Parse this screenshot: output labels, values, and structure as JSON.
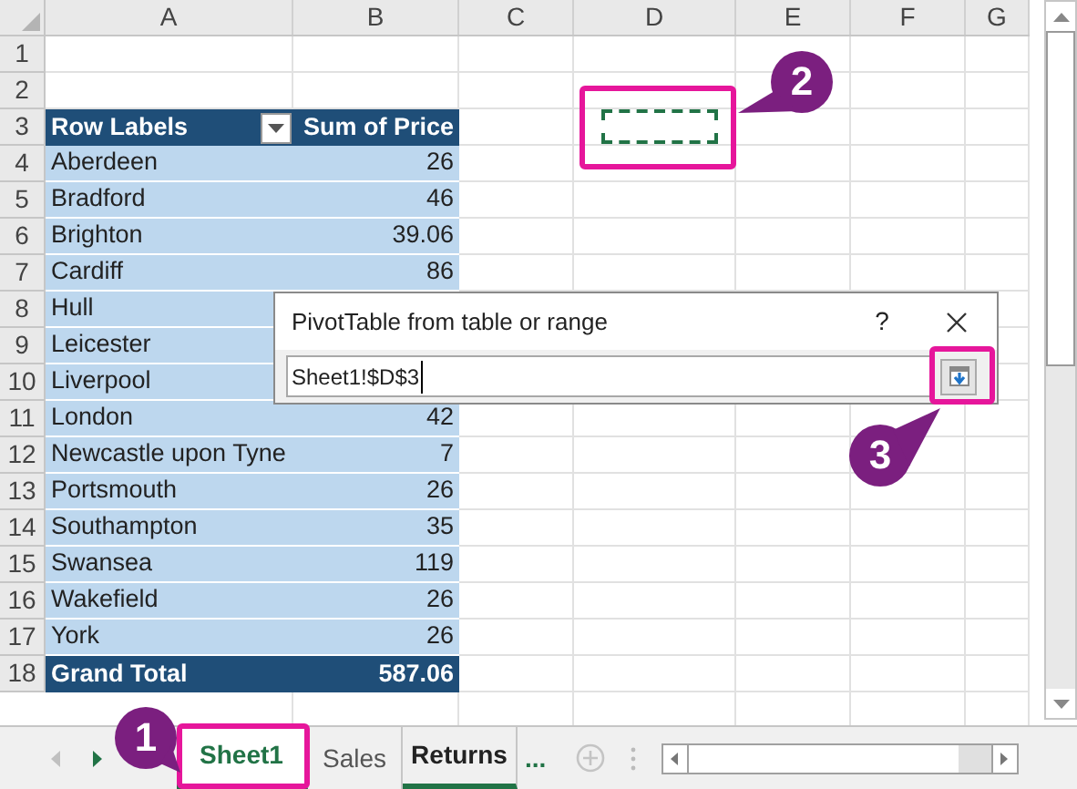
{
  "columns": [
    "A",
    "B",
    "C",
    "D",
    "E",
    "F",
    "G"
  ],
  "row_numbers": [
    "1",
    "2",
    "3",
    "4",
    "5",
    "6",
    "7",
    "8",
    "9",
    "10",
    "11",
    "12",
    "13",
    "14",
    "15",
    "16",
    "17",
    "18"
  ],
  "pivot_table": {
    "row_labels": "Row Labels",
    "value_header": "Sum of Price",
    "rows": [
      {
        "label": "Aberdeen",
        "value": "26"
      },
      {
        "label": "Bradford",
        "value": "46"
      },
      {
        "label": "Brighton",
        "value": "39.06"
      },
      {
        "label": "Cardiff",
        "value": "86"
      },
      {
        "label": "Hull"
      },
      {
        "label": "Leicester"
      },
      {
        "label": "Liverpool"
      },
      {
        "label": "London",
        "value": "42"
      },
      {
        "label": "Newcastle upon Tyne",
        "value": "7"
      },
      {
        "label": "Portsmouth",
        "value": "26"
      },
      {
        "label": "Southampton",
        "value": "35"
      },
      {
        "label": "Swansea",
        "value": "119"
      },
      {
        "label": "Wakefield",
        "value": "26"
      },
      {
        "label": "York",
        "value": "26"
      }
    ],
    "total": {
      "label": "Grand Total",
      "value": "587.06"
    }
  },
  "dialog": {
    "title": "PivotTable from table or range",
    "help": "?",
    "range_value": "Sheet1!$D$3"
  },
  "sheet_tabs": [
    {
      "label": "Sheet1",
      "selected": true,
      "grouped": true
    },
    {
      "label": "Sales",
      "selected": false,
      "grouped": false
    },
    {
      "label": "Returns",
      "selected": false,
      "grouped": true
    }
  ],
  "more_sheets": "...",
  "callouts": [
    {
      "number": "1"
    },
    {
      "number": "2"
    },
    {
      "number": "3"
    }
  ]
}
